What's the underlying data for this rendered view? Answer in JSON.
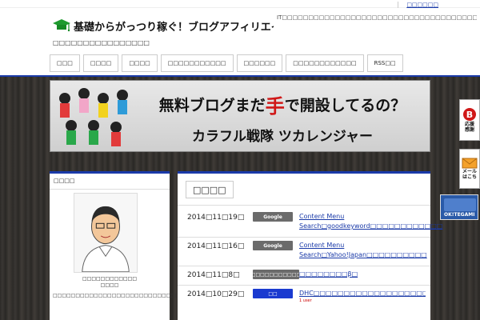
{
  "header": {
    "site_title": "基礎からがっつり稼ぐ！ブログアフィリエイト教室",
    "site_subtitle": "□□□□□□□□□□□□□□□□",
    "site_description": "IT□□□□□□□□□□□□□□□□□□□□□□□□□□□□□□□□□□□□□□□",
    "top_link": "□□□□□□"
  },
  "nav": {
    "items": [
      {
        "label": "□□□"
      },
      {
        "label": "□□□□"
      },
      {
        "label": "□□□□"
      },
      {
        "label": "□□□□□□□□□□□"
      },
      {
        "label": "□□□□□□"
      },
      {
        "label": "□□□□□□□□□□□□"
      },
      {
        "label": "RSS□□"
      }
    ]
  },
  "banner": {
    "headline": "無料ブログまだ手で開設してるの？",
    "subline": "カラフル戦隊 ツカレンジャー",
    "accent_char_color": "#d01818"
  },
  "sidebar": {
    "title": "□□□□",
    "caption_line1": "□□□□□□□□□□□□",
    "caption_line2": "□□□□",
    "profile_text": "□□□□□□□□□□□□□□□□□□□□□□□□□□□□□□□□□□□□□□□□□□□□□□□□□□□□"
  },
  "main": {
    "title": "□□□□",
    "posts": [
      {
        "date": "2014□11□19□",
        "category": "Google",
        "cat_color": "#6b6b6b",
        "title": "Content Menu Search□goodkeyword□□□□□□□□□□□□"
      },
      {
        "date": "2014□11□16□",
        "category": "Google",
        "cat_color": "#6b6b6b",
        "title": "Content Menu Search□Yahoo!Japan□□□□□□□□□□"
      },
      {
        "date": "2014□11□8□",
        "category": "□□□□□□□□□□□",
        "cat_color": "#6b6b6b",
        "title": "□□□□□□□□β□"
      },
      {
        "date": "2014□10□29□",
        "category": "□□",
        "cat_color": "#1a3ad0",
        "title": "DHC□□□□□□□□□□□□□□□□□□□□□",
        "meta": "1 user"
      }
    ]
  },
  "side_buttons": {
    "btn1_label": "応援\n感謝",
    "btn2_label": "メール\nはこち",
    "btn3_label": "OK!TEGAMI"
  }
}
